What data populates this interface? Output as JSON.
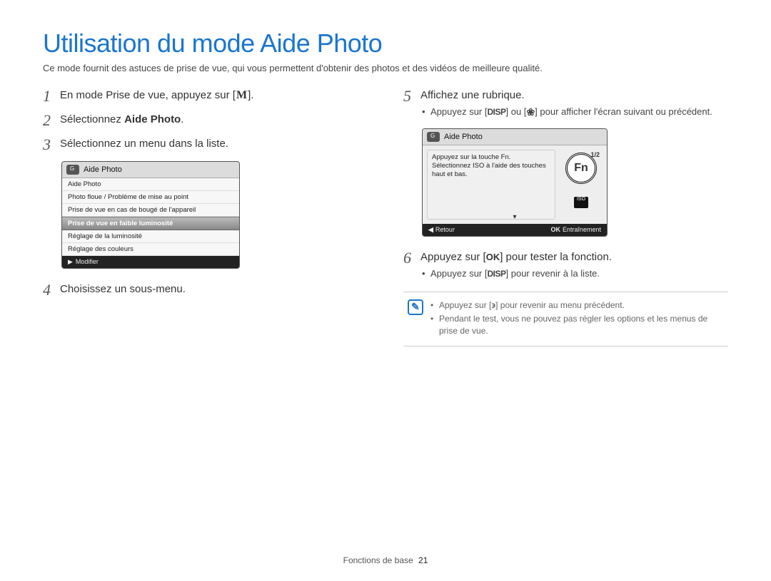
{
  "title": "Utilisation du mode Aide Photo",
  "intro": "Ce mode fournit des astuces de prise de vue, qui vous permettent d'obtenir des photos et des vidéos de meilleure qualité.",
  "steps": {
    "s1_pre": "En mode Prise de vue, appuyez sur [",
    "s1_icon": "M",
    "s1_post": "].",
    "s2_pre": "Sélectionnez ",
    "s2_bold": "Aide Photo",
    "s2_post": ".",
    "s3": "Sélectionnez un menu dans la liste.",
    "s4": "Choisissez un sous-menu.",
    "s5": "Affichez une rubrique.",
    "s5_b_pre": "Appuyez sur [",
    "s5_b_disp": "DISP",
    "s5_b_mid": "] ou [",
    "s5_b_flower": "❀",
    "s5_b_post": "] pour afficher l'écran suivant ou précédent.",
    "s6_pre": "Appuyez sur [",
    "s6_ok": "OK",
    "s6_post": "] pour tester la fonction.",
    "s6_b_pre": "Appuyez sur [",
    "s6_b_disp": "DISP",
    "s6_b_post": "] pour revenir à la liste."
  },
  "screen1": {
    "title": "Aide Photo",
    "rows": [
      "Aide Photo",
      "Photo floue / Problème de mise au point",
      "Prise de vue en cas de bougé de l'appareil",
      "Prise de vue en faible luminosité",
      "Réglage de la luminosité",
      "Réglage des couleurs"
    ],
    "selected_index": 3,
    "foot": "Modifier",
    "foot_arrow": "▶"
  },
  "screen2": {
    "title": "Aide Photo",
    "page": "1/2",
    "instr": "Appuyez sur la touche Fn. Sélectionnez ISO à l'aide des touches haut et bas.",
    "fn": "Fn",
    "iso": "ISO",
    "back_arrow": "◀",
    "back": "Retour",
    "ok": "OK",
    "train": "Entraînement",
    "down": "▾"
  },
  "note": {
    "icon": "✎",
    "b1_pre": "Appuyez sur [",
    "b1_icon": "϶",
    "b1_post": "] pour revenir au menu précédent.",
    "b2": "Pendant le test, vous ne pouvez pas régler les options et les menus de prise de vue."
  },
  "footer": {
    "section": "Fonctions de base",
    "page": "21"
  }
}
